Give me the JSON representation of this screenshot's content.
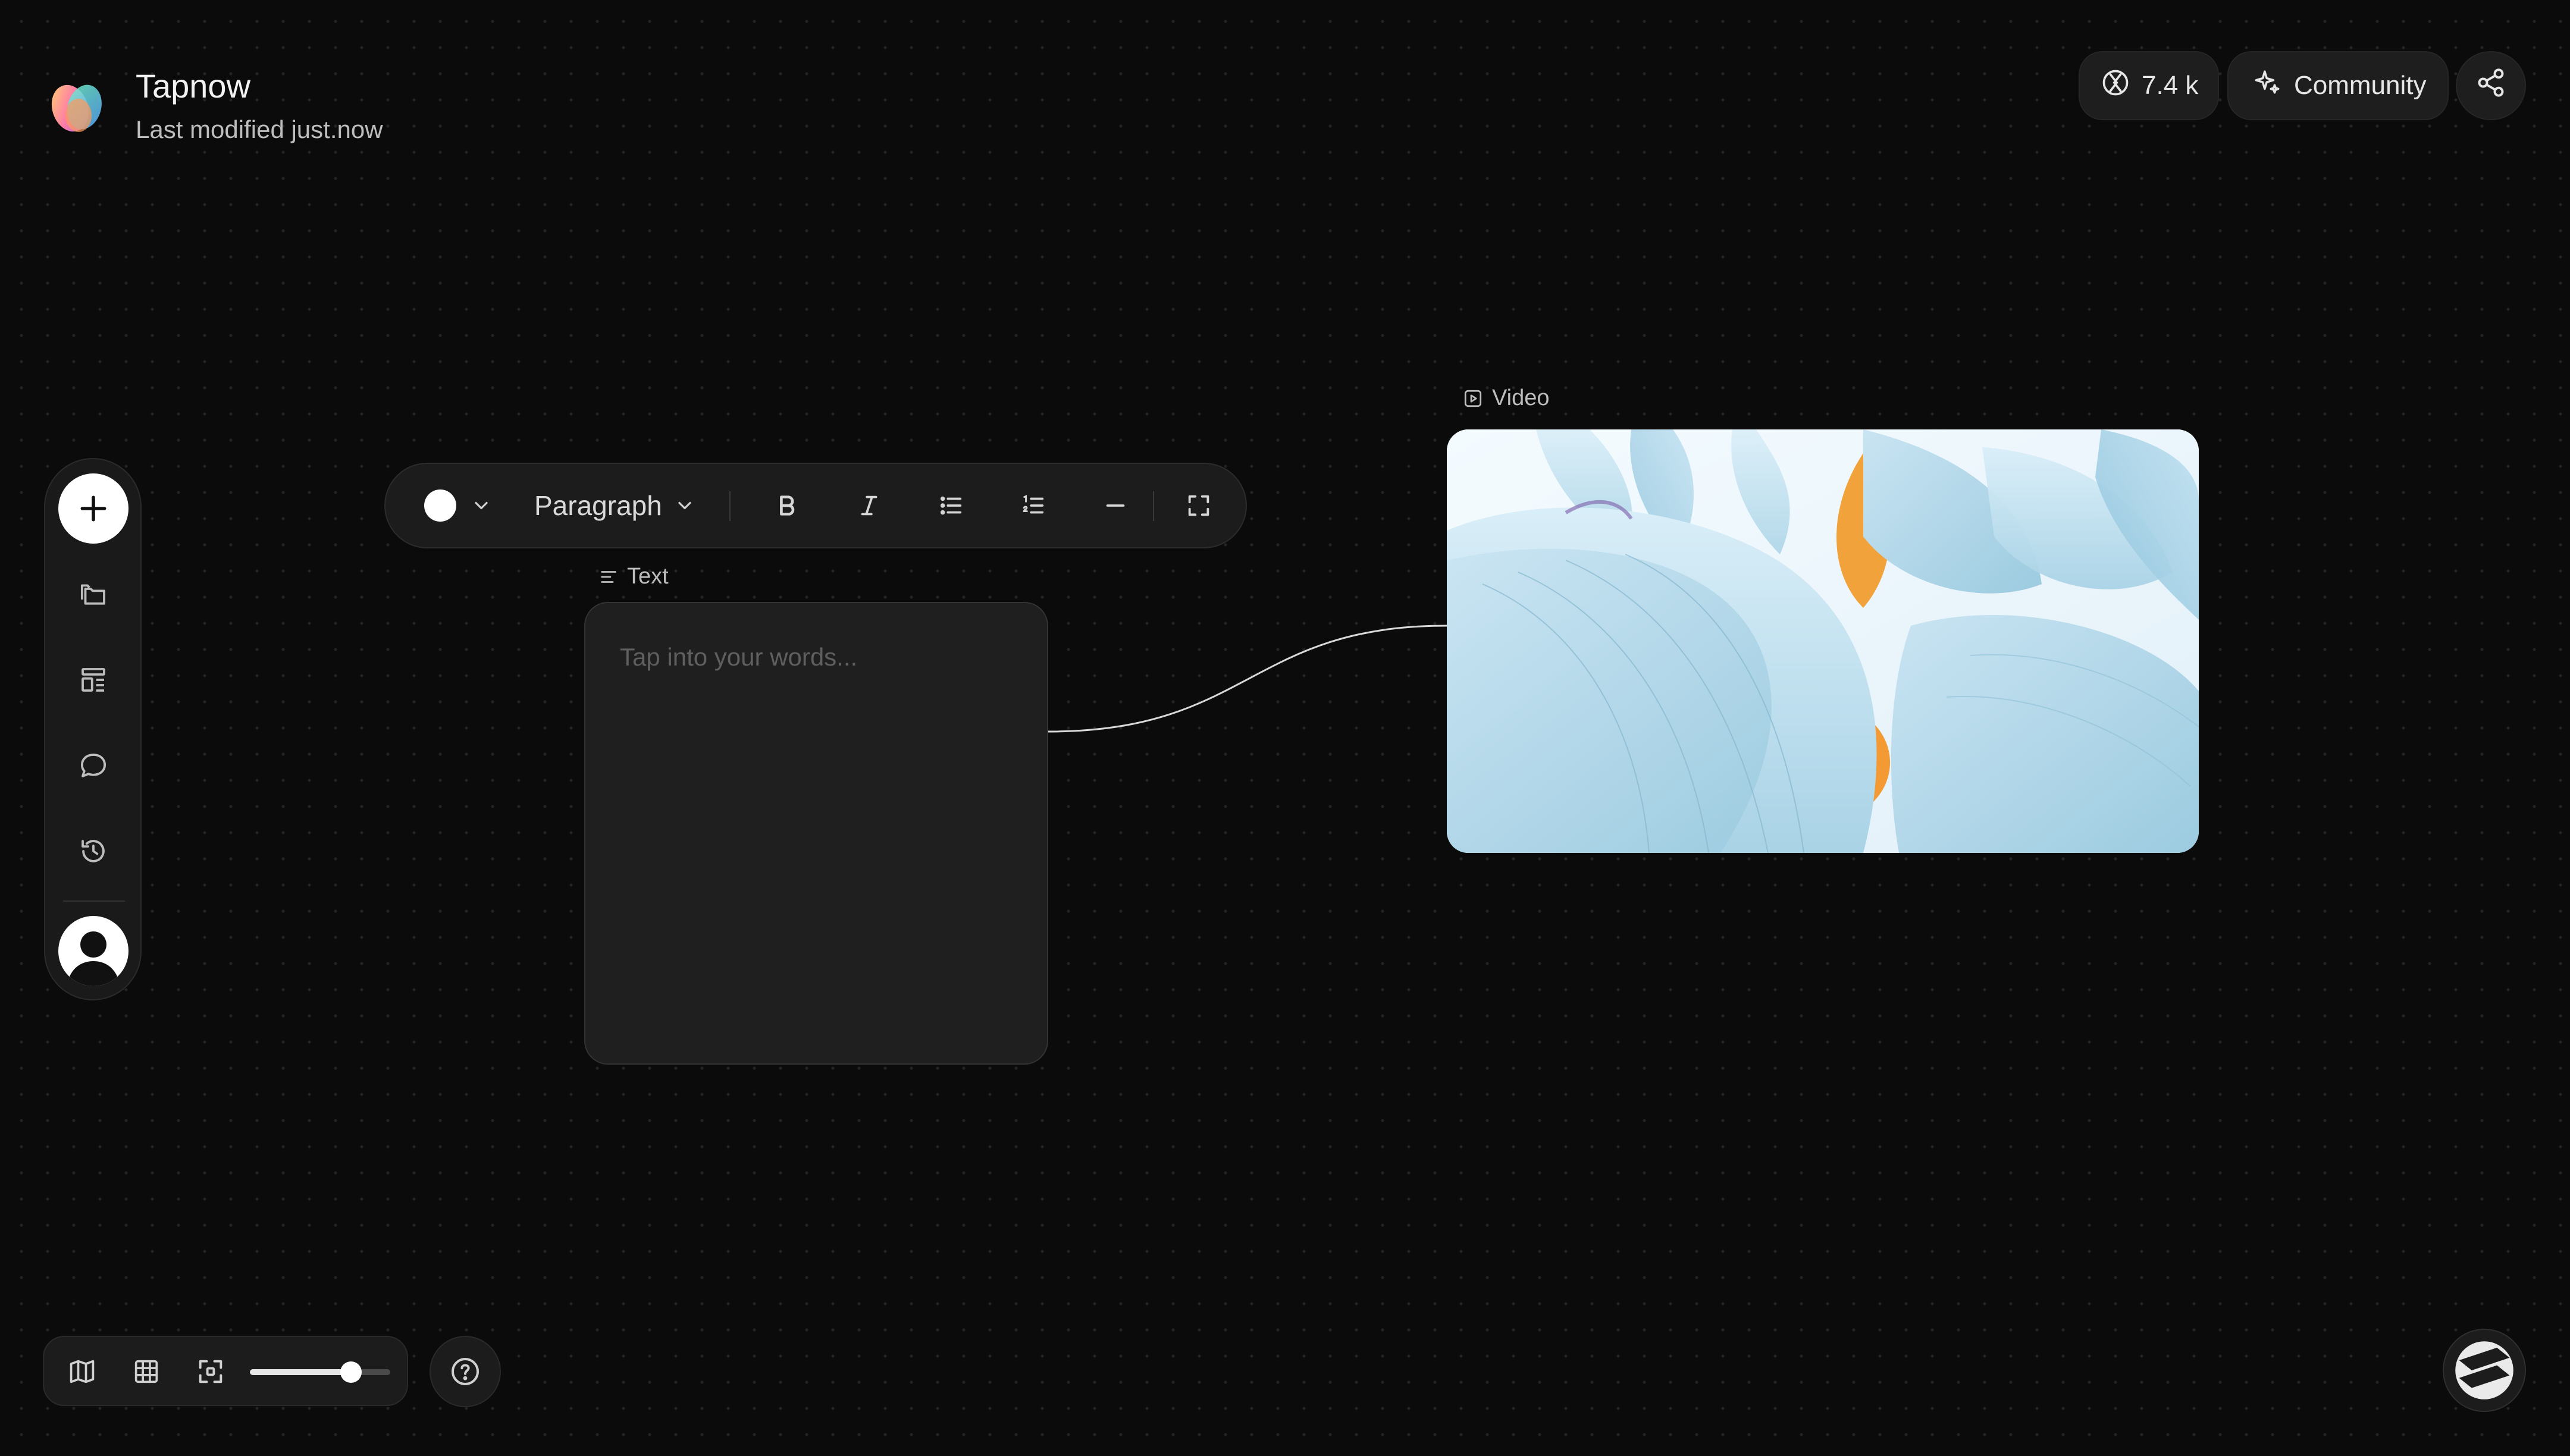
{
  "app": {
    "title": "Tapnow",
    "subtitle": "Last modified just.now"
  },
  "header": {
    "credits": "7.4 k",
    "community_label": "Community"
  },
  "sidebar": {
    "items": [
      {
        "name": "add",
        "icon": "plus-icon"
      },
      {
        "name": "projects",
        "icon": "folders-icon"
      },
      {
        "name": "templates",
        "icon": "layout-icon"
      },
      {
        "name": "comments",
        "icon": "chat-bubble-icon"
      },
      {
        "name": "history",
        "icon": "history-icon"
      },
      {
        "name": "profile",
        "icon": "avatar"
      }
    ]
  },
  "text_toolbar": {
    "color": "#ffffff",
    "block_type": "Paragraph",
    "buttons": [
      "bold-icon",
      "italic-icon",
      "bullet-list-icon",
      "numbered-list-icon",
      "divider-icon",
      "fullscreen-icon"
    ]
  },
  "text_node": {
    "label": "Text",
    "placeholder": "Tap into your words..."
  },
  "video_node": {
    "label": "Video",
    "content": "pale blue lotus petals image"
  },
  "bottom_toolbar": {
    "icons": [
      "map-icon",
      "grid-icon",
      "fit-view-icon"
    ],
    "zoom_level": 0.72
  },
  "colors": {
    "background": "#0b0b0b",
    "panel": "#1c1c1c",
    "accent": "#ffffff"
  }
}
